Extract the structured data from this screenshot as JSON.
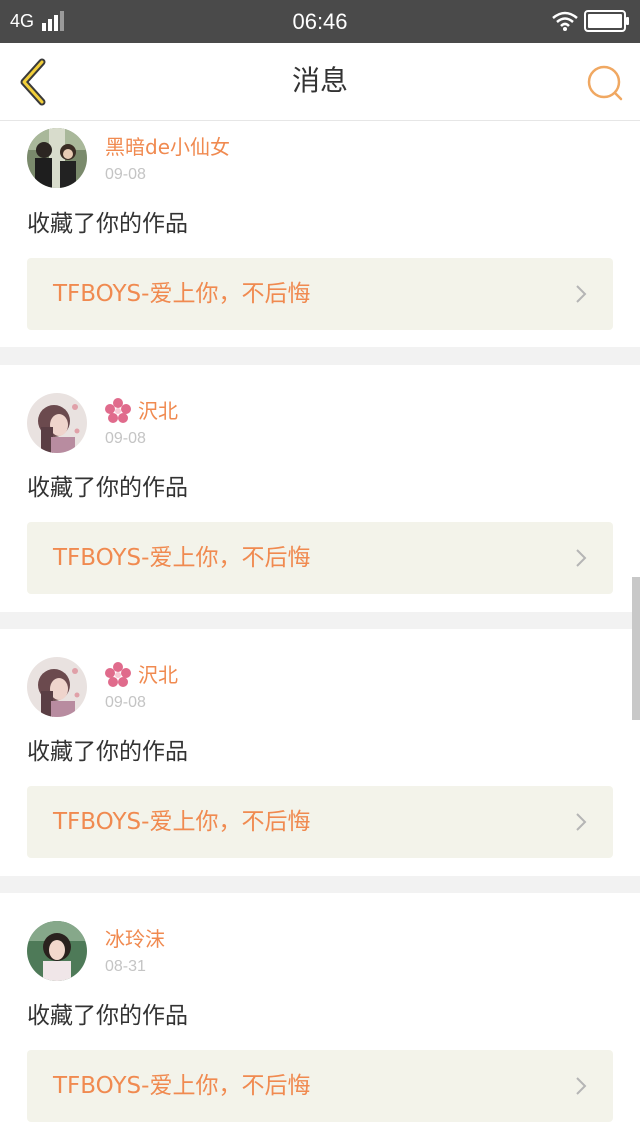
{
  "status_bar": {
    "network": "4G",
    "time": "06:46",
    "icons": [
      "signal-icon",
      "wifi-icon",
      "battery-icon"
    ]
  },
  "nav": {
    "title": "消息",
    "back_icon": "chevron-left-icon",
    "search_icon": "search-icon",
    "accent_color": "#f0a862"
  },
  "messages": [
    {
      "username": "黑暗de小仙女",
      "badge": false,
      "date": "09-08",
      "action": "收藏了你的作品",
      "work_title": "TFBOYS-爱上你，不后悔"
    },
    {
      "username": "沢北",
      "badge": true,
      "date": "09-08",
      "action": "收藏了你的作品",
      "work_title": "TFBOYS-爱上你，不后悔"
    },
    {
      "username": "沢北",
      "badge": true,
      "date": "09-08",
      "action": "收藏了你的作品",
      "work_title": "TFBOYS-爱上你，不后悔"
    },
    {
      "username": "冰玲沫",
      "badge": false,
      "date": "08-31",
      "action": "收藏了你的作品",
      "work_title": "TFBOYS-爱上你，不后悔"
    }
  ],
  "colors": {
    "username": "#f08a50",
    "date": "#c4c4c4",
    "link_background": "#f3f3ea",
    "page_background": "#f2f2f2"
  }
}
